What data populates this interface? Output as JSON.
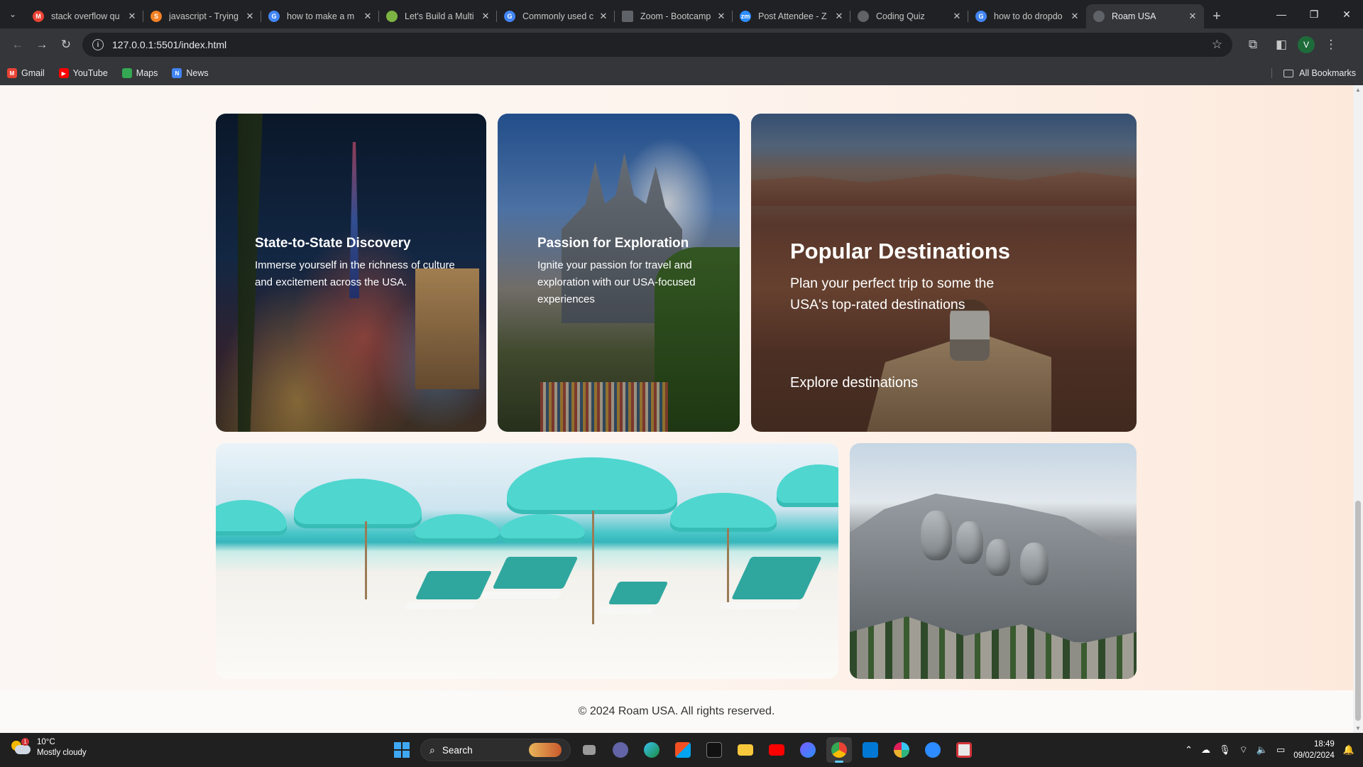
{
  "browser": {
    "tabs": [
      {
        "title": "stack overflow qu",
        "favicon": "gmail-icon",
        "color": "#ea4335"
      },
      {
        "title": "javascript - Trying",
        "favicon": "stackoverflow-icon",
        "color": "#f48024"
      },
      {
        "title": "how to make a m",
        "favicon": "google-icon",
        "color": "#4285f4"
      },
      {
        "title": "Let's Build a Multi",
        "favicon": "leaf-icon",
        "color": "#7cb342"
      },
      {
        "title": "Commonly used c",
        "favicon": "google-icon",
        "color": "#4285f4"
      },
      {
        "title": "Zoom - Bootcamp",
        "favicon": "zoom-doc-icon",
        "color": "#5f6368"
      },
      {
        "title": "Post Attendee - Z",
        "favicon": "zoom-icon",
        "color": "#2d8cff"
      },
      {
        "title": "Coding Quiz",
        "favicon": "globe-icon",
        "color": "#5f6368"
      },
      {
        "title": "how to do dropdo",
        "favicon": "google-icon",
        "color": "#4285f4"
      },
      {
        "title": "Roam USA",
        "favicon": "globe-icon",
        "color": "#5f6368",
        "active": true
      }
    ],
    "url": "127.0.0.1:5501/index.html",
    "profile_initial": "V",
    "bookmarks": [
      {
        "label": "Gmail",
        "icon": "gmail-icon",
        "color": "#ea4335"
      },
      {
        "label": "YouTube",
        "icon": "youtube-icon",
        "color": "#ff0000"
      },
      {
        "label": "Maps",
        "icon": "maps-icon",
        "color": "#34a853"
      },
      {
        "label": "News",
        "icon": "news-icon",
        "color": "#4285f4"
      }
    ],
    "all_bookmarks_label": "All Bookmarks"
  },
  "page": {
    "cards": {
      "vegas": {
        "title": "State-to-State Discovery",
        "text": "Immerse yourself in the richness of culture and excitement across the USA."
      },
      "hogwarts": {
        "title": "Passion for Exploration",
        "text": "Ignite your passion for travel and exploration with our USA-focused experiences"
      },
      "canyon": {
        "title": "Popular Destinations",
        "text": "Plan your perfect trip to some the USA's top-rated destinations",
        "link": "Explore destinations"
      }
    },
    "footer": "© 2024 Roam USA. All rights reserved."
  },
  "taskbar": {
    "weather": {
      "temp": "10°C",
      "condition": "Mostly cloudy",
      "badge": "1"
    },
    "search_label": "Search",
    "time": "18:49",
    "date": "09/02/2024",
    "accent": "#60cdff"
  }
}
